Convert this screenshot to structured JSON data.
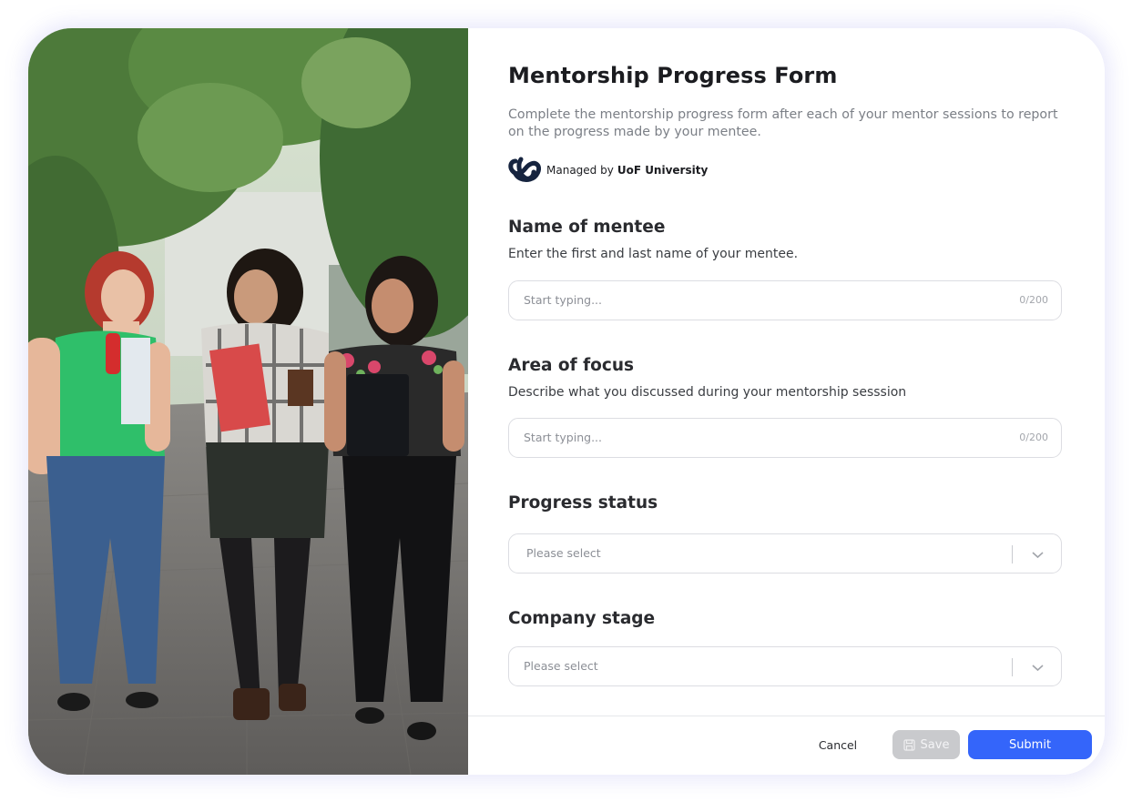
{
  "form": {
    "title": "Mentorship Progress Form",
    "description": "Complete the mentorship progress form after each of your mentor sessions to report on the progress made by your mentee.",
    "managed_by_prefix": "Managed by",
    "managed_by_org": "UoF University",
    "fields": [
      {
        "label": "Name of mentee",
        "help": "Enter the first and last name of your mentee.",
        "placeholder": "Start typing...",
        "counter": "0/200"
      },
      {
        "label": "Area of focus",
        "help": "Describe what you discussed during your mentorship sesssion",
        "placeholder": "Start typing...",
        "counter": "0/200"
      }
    ],
    "selects": [
      {
        "label": "Progress status",
        "placeholder": "Please select"
      },
      {
        "label": "Company stage",
        "placeholder": "Please select"
      }
    ]
  },
  "footer": {
    "cancel_label": "Cancel",
    "save_label": "Save",
    "submit_label": "Submit"
  },
  "colors": {
    "accent": "#3465fa",
    "disabled": "#c9cacd",
    "logo": "#16243f"
  },
  "icons": {
    "logo": "uof-logo-icon",
    "select_toggle": "chevron-down-icon",
    "save": "floppy-disk-icon"
  }
}
